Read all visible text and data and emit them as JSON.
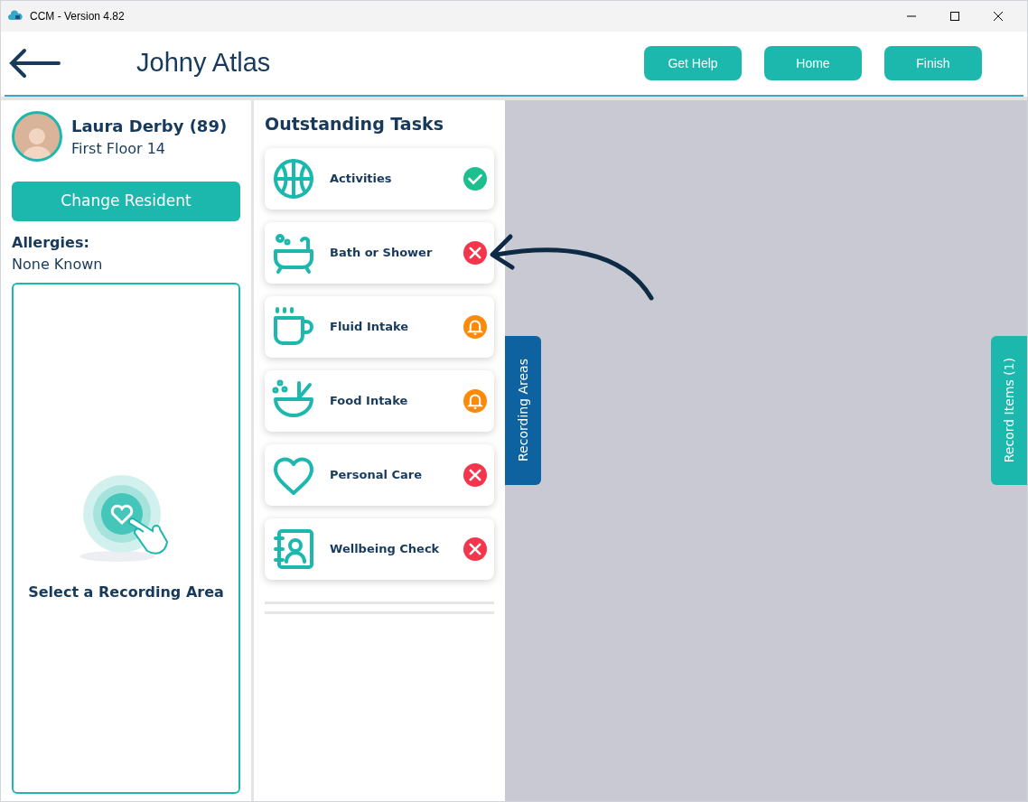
{
  "window": {
    "title": "CCM - Version 4.82"
  },
  "header": {
    "title": "Johny Atlas",
    "buttons": [
      "Get Help",
      "Home",
      "Finish"
    ]
  },
  "resident": {
    "name": "Laura Derby (89)",
    "location": "First Floor 14",
    "change_button": "Change Resident",
    "allergies_label": "Allergies:",
    "allergies_value": "None Known"
  },
  "recording_area": {
    "prompt": "Select a Recording Area"
  },
  "tasks": {
    "title": "Outstanding Tasks",
    "items": [
      {
        "label": "Activities",
        "kind": "done"
      },
      {
        "label": "Bath or Shower",
        "kind": "missed"
      },
      {
        "label": "Fluid Intake",
        "kind": "due"
      },
      {
        "label": "Food Intake",
        "kind": "due"
      },
      {
        "label": "Personal Care",
        "kind": "missed"
      },
      {
        "label": "Wellbeing Check",
        "kind": "missed"
      }
    ]
  },
  "side_tabs": {
    "left": "Recording Areas",
    "right": "Record Items (1)"
  }
}
